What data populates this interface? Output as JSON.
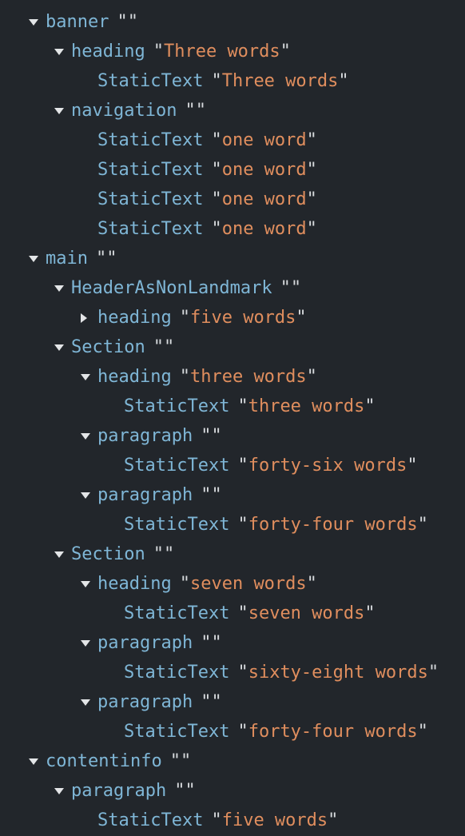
{
  "panel": {
    "title": "Accessibility Tree",
    "background_color": "#22262b",
    "role_color": "#7fb6d6",
    "value_color": "#e08e5e",
    "quote_color": "#d7dadd",
    "twisty_color": "#e3e5e7"
  },
  "nodes": [
    {
      "id": 0,
      "level": 2,
      "twisty": "none",
      "role": "",
      "value": "",
      "clipped": true
    },
    {
      "id": 1,
      "level": 1,
      "twisty": "open",
      "role": "banner",
      "value": ""
    },
    {
      "id": 2,
      "level": 2,
      "twisty": "open",
      "role": "heading",
      "value": "Three words"
    },
    {
      "id": 3,
      "level": 3,
      "twisty": "none",
      "role": "StaticText",
      "value": "Three words"
    },
    {
      "id": 4,
      "level": 2,
      "twisty": "open",
      "role": "navigation",
      "value": ""
    },
    {
      "id": 5,
      "level": 3,
      "twisty": "none",
      "role": "StaticText",
      "value": "one word"
    },
    {
      "id": 6,
      "level": 3,
      "twisty": "none",
      "role": "StaticText",
      "value": "one word"
    },
    {
      "id": 7,
      "level": 3,
      "twisty": "none",
      "role": "StaticText",
      "value": "one word"
    },
    {
      "id": 8,
      "level": 3,
      "twisty": "none",
      "role": "StaticText",
      "value": "one word"
    },
    {
      "id": 9,
      "level": 1,
      "twisty": "open",
      "role": "main",
      "value": ""
    },
    {
      "id": 10,
      "level": 2,
      "twisty": "open",
      "role": "HeaderAsNonLandmark",
      "value": ""
    },
    {
      "id": 11,
      "level": 3,
      "twisty": "closed",
      "role": "heading",
      "value": "five words"
    },
    {
      "id": 12,
      "level": 2,
      "twisty": "open",
      "role": "Section",
      "value": ""
    },
    {
      "id": 13,
      "level": 3,
      "twisty": "open",
      "role": "heading",
      "value": "three words"
    },
    {
      "id": 14,
      "level": 4,
      "twisty": "none",
      "role": "StaticText",
      "value": "three words"
    },
    {
      "id": 15,
      "level": 3,
      "twisty": "open",
      "role": "paragraph",
      "value": ""
    },
    {
      "id": 16,
      "level": 4,
      "twisty": "none",
      "role": "StaticText",
      "value": "forty-six words"
    },
    {
      "id": 17,
      "level": 3,
      "twisty": "open",
      "role": "paragraph",
      "value": ""
    },
    {
      "id": 18,
      "level": 4,
      "twisty": "none",
      "role": "StaticText",
      "value": "forty-four words"
    },
    {
      "id": 19,
      "level": 2,
      "twisty": "open",
      "role": "Section",
      "value": ""
    },
    {
      "id": 20,
      "level": 3,
      "twisty": "open",
      "role": "heading",
      "value": "seven words"
    },
    {
      "id": 21,
      "level": 4,
      "twisty": "none",
      "role": "StaticText",
      "value": "seven words"
    },
    {
      "id": 22,
      "level": 3,
      "twisty": "open",
      "role": "paragraph",
      "value": ""
    },
    {
      "id": 23,
      "level": 4,
      "twisty": "none",
      "role": "StaticText",
      "value": "sixty-eight words"
    },
    {
      "id": 24,
      "level": 3,
      "twisty": "open",
      "role": "paragraph",
      "value": ""
    },
    {
      "id": 25,
      "level": 4,
      "twisty": "none",
      "role": "StaticText",
      "value": "forty-four words"
    },
    {
      "id": 26,
      "level": 1,
      "twisty": "open",
      "role": "contentinfo",
      "value": ""
    },
    {
      "id": 27,
      "level": 2,
      "twisty": "open",
      "role": "paragraph",
      "value": ""
    },
    {
      "id": 28,
      "level": 3,
      "twisty": "none",
      "role": "StaticText",
      "value": "five words"
    }
  ]
}
